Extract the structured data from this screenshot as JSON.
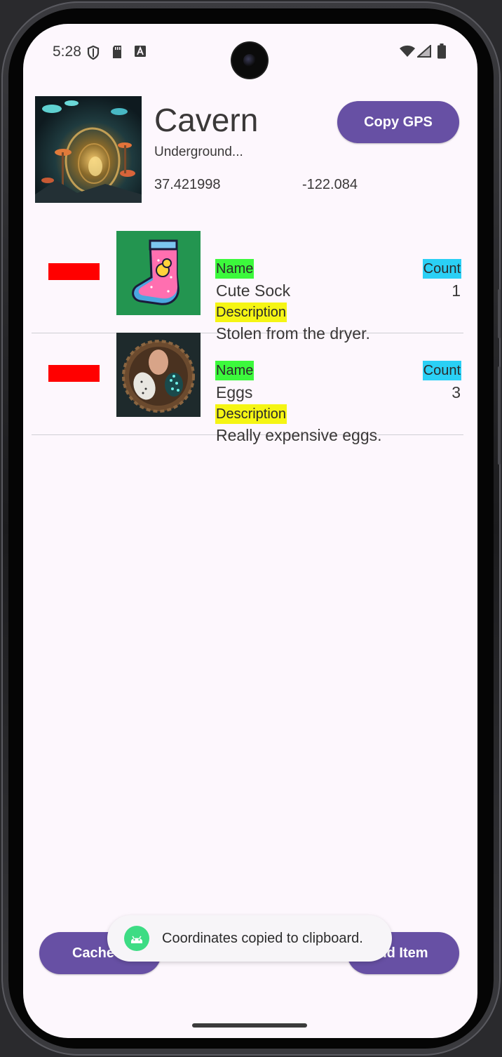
{
  "status_bar": {
    "time": "5:28",
    "icons": [
      "shield-icon",
      "sd-card-icon",
      "keyboard-a-icon",
      "wifi-icon",
      "cell-signal-icon",
      "battery-icon"
    ]
  },
  "location": {
    "title": "Cavern",
    "description": "Underground...",
    "latitude": "37.421998",
    "longitude": "-122.084",
    "copy_gps_label": "Copy GPS"
  },
  "items": [
    {
      "name_label": "Name",
      "name": "Cute Sock",
      "description_label": "Description",
      "description": "Stolen from the dryer.",
      "count_label": "Count",
      "count": "1",
      "image": "sock-image"
    },
    {
      "name_label": "Name",
      "name": "Eggs",
      "description_label": "Description",
      "description": "Really expensive eggs.",
      "count_label": "Count",
      "count": "3",
      "image": "eggs-image"
    }
  ],
  "bottom": {
    "cache_button_label": "Cache B",
    "add_item_button_label": "dd Item"
  },
  "toast": {
    "text": "Coordinates copied to clipboard."
  },
  "colors": {
    "accent": "#6750a4",
    "delete": "#ff0000",
    "name_label_bg": "#3cf93c",
    "description_label_bg": "#f5f514",
    "count_label_bg": "#2ad0f5",
    "screen_bg": "#fdf7fd"
  }
}
